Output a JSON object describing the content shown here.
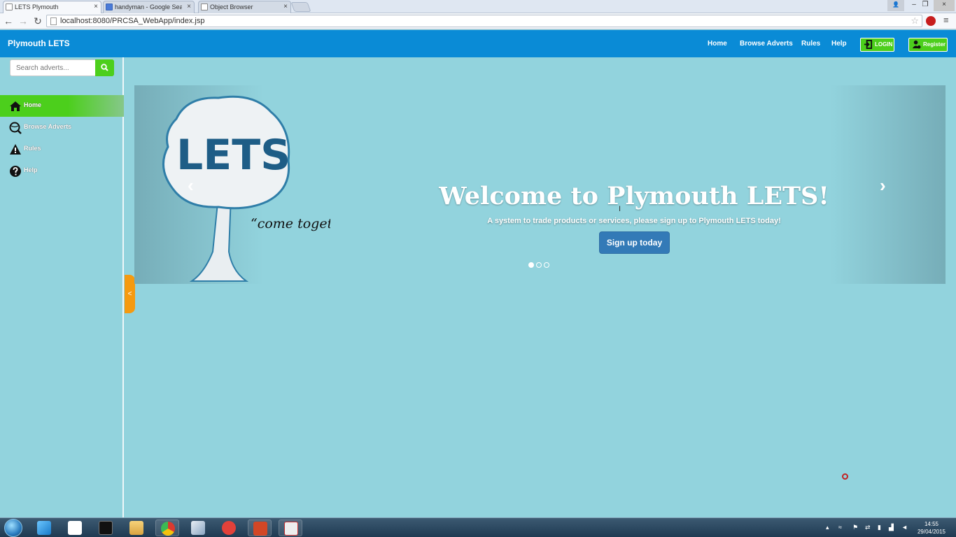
{
  "browser": {
    "tabs": [
      {
        "title": "LETS Plymouth",
        "active": true
      },
      {
        "title": "handyman - Google Search",
        "active": false
      },
      {
        "title": "Object Browser",
        "active": false
      }
    ],
    "url": "localhost:8080/PRCSA_WebApp/index.jsp",
    "close_glyph": "×",
    "back_glyph": "←",
    "forward_glyph": "→",
    "reload_glyph": "↻",
    "star_glyph": "☆",
    "menu_glyph": "≡",
    "minimize_glyph": "–",
    "restore_glyph": "❐",
    "user_glyph": "👤"
  },
  "navbar": {
    "brand": "Plymouth LETS",
    "links": [
      "Home",
      "Browse Adverts",
      "Rules",
      "Help"
    ],
    "login_label": "LOGIN",
    "register_label": "Register",
    "color": "#0a8bd6",
    "button_color": "#4ccf1c"
  },
  "sidebar": {
    "search_placeholder": "Search adverts...",
    "items": [
      {
        "label": "Home",
        "icon": "home-icon",
        "active": true
      },
      {
        "label": "Browse Adverts",
        "icon": "search-globe-icon",
        "active": false
      },
      {
        "label": "Rules",
        "icon": "warning-icon",
        "active": false
      },
      {
        "label": "Help",
        "icon": "help-icon",
        "active": false
      }
    ],
    "collapse_glyph": "<"
  },
  "carousel": {
    "logo_text": "LETS",
    "logo_tagline": "“come together”",
    "title": "Welcome to Plymouth LETS!",
    "subtitle": "A system to trade products or services, please sign up to Plymouth LETS today!",
    "button_label": "Sign up today",
    "prev_glyph": "‹",
    "next_glyph": "›",
    "slide_count": 3,
    "active_slide": 0
  },
  "taskbar": {
    "time": "14:55",
    "date": "29/04/2015"
  },
  "colors": {
    "background": "#92d3dd",
    "accent_orange": "#f59a10",
    "primary_button": "#337ab7"
  }
}
